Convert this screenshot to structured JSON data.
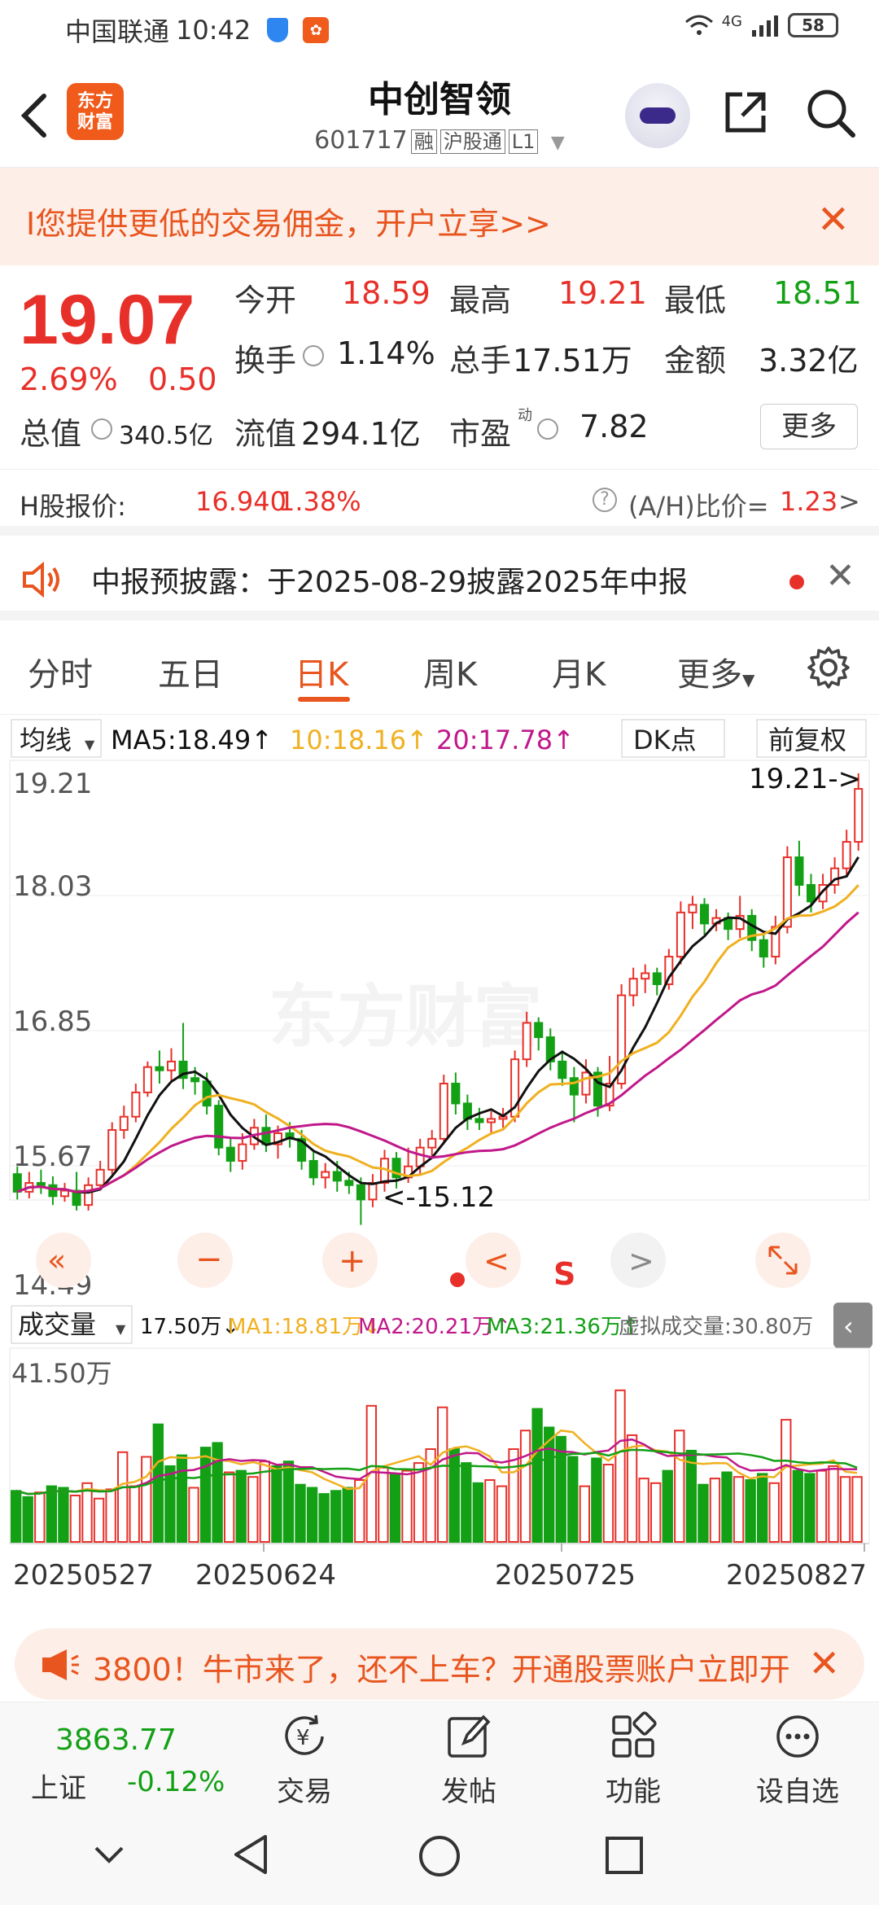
{
  "status_bar": {
    "carrier": "中国联通",
    "time": "10:42",
    "network": "4G",
    "battery": "58"
  },
  "header": {
    "logo_text": "东方\n财富",
    "stock_name": "中创智领",
    "stock_code": "601717",
    "tags": [
      "融",
      "沪股通",
      "L1"
    ]
  },
  "promo_banner": {
    "text": "I您提供更低的交易佣金，开户立享>>"
  },
  "quote": {
    "price": "19.07",
    "change_pct": "2.69%",
    "change_amt": "0.50",
    "rows": [
      [
        {
          "label": "今开",
          "value": "18.59",
          "color": "red"
        },
        {
          "label": "最高",
          "value": "19.21",
          "color": "red"
        },
        {
          "label": "最低",
          "value": "18.51",
          "color": "green"
        }
      ],
      [
        {
          "label": "换手",
          "value": "1.14%",
          "color": "black"
        },
        {
          "label": "总手",
          "value": "17.51万",
          "color": "black"
        },
        {
          "label": "金额",
          "value": "3.32亿",
          "color": "black"
        }
      ],
      [
        {
          "label": "总值",
          "value": "340.5亿",
          "color": "black"
        },
        {
          "label": "流值",
          "value": "294.1亿",
          "color": "black"
        },
        {
          "label": "市盈",
          "value": "7.82",
          "color": "black"
        }
      ]
    ],
    "more_label": "更多",
    "pe_superscript": "动"
  },
  "h_share": {
    "label": "H股报价:",
    "price": "16.940",
    "pct": "1.38%",
    "ratio_label": "(A/H)比价=",
    "ratio": "1.23",
    "arrow": ">"
  },
  "notice": {
    "text": "中报预披露：于2025-08-29披露2025年中报"
  },
  "tabs": [
    "分时",
    "五日",
    "日K",
    "周K",
    "月K",
    "更多"
  ],
  "active_tab": 2,
  "ma_bar": {
    "selector": "均线",
    "ma5": "MA5:18.49↑",
    "ma10": "10:18.16↑",
    "ma20": "20:17.78↑",
    "dk": "DK点",
    "adjust": "前复权"
  },
  "vol_bar": {
    "selector": "成交量",
    "vol": "17.50万↓",
    "ma1": "MA1:18.81万↓",
    "ma2": "MA2:20.21万↑",
    "ma3": "MA3:21.36万↑",
    "virtual": "虚拟成交量:30.80万"
  },
  "chart_data": {
    "type": "candlestick",
    "price_ticks": [
      "19.21",
      "18.03",
      "16.85",
      "15.67",
      "14.49"
    ],
    "price_range": [
      14.49,
      19.21
    ],
    "max_annotation": "19.21->",
    "min_annotation": "<-15.12",
    "volume_max_label": "41.50万",
    "dates": [
      "20250527",
      "20250624",
      "20250725",
      "20250827"
    ],
    "candles": [
      [
        15.58,
        15.42,
        15.65,
        15.35
      ],
      [
        15.42,
        15.5,
        15.6,
        15.36
      ],
      [
        15.5,
        15.48,
        15.62,
        15.4
      ],
      [
        15.48,
        15.38,
        15.56,
        15.3
      ],
      [
        15.38,
        15.43,
        15.5,
        15.33
      ],
      [
        15.43,
        15.3,
        15.6,
        15.25
      ],
      [
        15.3,
        15.48,
        15.55,
        15.25
      ],
      [
        15.48,
        15.62,
        15.7,
        15.45
      ],
      [
        15.62,
        15.98,
        16.05,
        15.58
      ],
      [
        15.98,
        16.1,
        16.2,
        15.9
      ],
      [
        16.1,
        16.32,
        16.4,
        16.05
      ],
      [
        16.32,
        16.55,
        16.6,
        16.28
      ],
      [
        16.55,
        16.52,
        16.7,
        16.4
      ],
      [
        16.52,
        16.6,
        16.72,
        16.42
      ],
      [
        16.6,
        16.45,
        16.95,
        16.35
      ],
      [
        16.45,
        16.42,
        16.55,
        16.3
      ],
      [
        16.42,
        16.2,
        16.5,
        16.12
      ],
      [
        16.2,
        15.82,
        16.25,
        15.75
      ],
      [
        15.82,
        15.7,
        15.9,
        15.6
      ],
      [
        15.7,
        15.85,
        15.95,
        15.62
      ],
      [
        15.85,
        16.0,
        16.08,
        15.8
      ],
      [
        16.0,
        15.85,
        16.12,
        15.78
      ],
      [
        15.85,
        15.95,
        16.02,
        15.72
      ],
      [
        15.95,
        15.9,
        16.05,
        15.82
      ],
      [
        15.9,
        15.7,
        15.98,
        15.62
      ],
      [
        15.7,
        15.55,
        15.78,
        15.48
      ],
      [
        15.55,
        15.6,
        15.68,
        15.45
      ],
      [
        15.6,
        15.52,
        15.7,
        15.42
      ],
      [
        15.52,
        15.48,
        15.6,
        15.4
      ],
      [
        15.48,
        15.35,
        15.55,
        15.12
      ],
      [
        15.35,
        15.5,
        15.58,
        15.28
      ],
      [
        15.5,
        15.72,
        15.8,
        15.42
      ],
      [
        15.72,
        15.55,
        15.78,
        15.45
      ],
      [
        15.55,
        15.65,
        15.82,
        15.5
      ],
      [
        15.65,
        15.82,
        15.9,
        15.58
      ],
      [
        15.82,
        15.9,
        15.98,
        15.72
      ],
      [
        15.9,
        16.4,
        16.48,
        15.85
      ],
      [
        16.4,
        16.22,
        16.5,
        16.12
      ],
      [
        16.22,
        16.08,
        16.3,
        15.98
      ],
      [
        16.08,
        16.05,
        16.18,
        15.98
      ],
      [
        16.05,
        16.08,
        16.15,
        15.95
      ],
      [
        16.08,
        16.1,
        16.18,
        16.0
      ],
      [
        16.1,
        16.62,
        16.7,
        16.05
      ],
      [
        16.62,
        16.95,
        17.05,
        16.55
      ],
      [
        16.95,
        16.82,
        17.0,
        16.7
      ],
      [
        16.82,
        16.6,
        16.9,
        16.52
      ],
      [
        16.6,
        16.45,
        16.7,
        16.38
      ],
      [
        16.45,
        16.3,
        16.55,
        16.05
      ],
      [
        16.3,
        16.5,
        16.62,
        16.22
      ],
      [
        16.5,
        16.2,
        16.55,
        16.1
      ],
      [
        16.2,
        16.4,
        16.65,
        16.15
      ],
      [
        16.4,
        17.2,
        17.3,
        16.35
      ],
      [
        17.2,
        17.35,
        17.45,
        17.1
      ],
      [
        17.35,
        17.4,
        17.48,
        17.22
      ],
      [
        17.4,
        17.3,
        17.45,
        17.2
      ],
      [
        17.3,
        17.55,
        17.62,
        17.25
      ],
      [
        17.55,
        17.95,
        18.05,
        17.48
      ],
      [
        17.95,
        18.02,
        18.1,
        17.8
      ],
      [
        18.02,
        17.85,
        18.08,
        17.75
      ],
      [
        17.85,
        17.9,
        17.98,
        17.78
      ],
      [
        17.9,
        17.8,
        17.95,
        17.7
      ],
      [
        17.8,
        17.92,
        18.1,
        17.72
      ],
      [
        17.92,
        17.7,
        17.98,
        17.6
      ],
      [
        17.7,
        17.55,
        17.78,
        17.45
      ],
      [
        17.55,
        17.82,
        17.92,
        17.48
      ],
      [
        17.82,
        18.45,
        18.55,
        17.76
      ],
      [
        18.45,
        18.2,
        18.6,
        18.1
      ],
      [
        18.2,
        18.05,
        18.3,
        17.95
      ],
      [
        18.05,
        18.2,
        18.3,
        17.98
      ],
      [
        18.2,
        18.35,
        18.45,
        18.12
      ],
      [
        18.35,
        18.59,
        18.7,
        18.28
      ],
      [
        18.59,
        19.07,
        19.21,
        18.51
      ]
    ],
    "volumes": [
      [
        0.33,
        "d"
      ],
      [
        0.29,
        "d"
      ],
      [
        0.32,
        "u"
      ],
      [
        0.36,
        "d"
      ],
      [
        0.35,
        "d"
      ],
      [
        0.3,
        "u"
      ],
      [
        0.38,
        "u"
      ],
      [
        0.28,
        "u"
      ],
      [
        0.34,
        "u"
      ],
      [
        0.58,
        "u"
      ],
      [
        0.36,
        "u"
      ],
      [
        0.55,
        "u"
      ],
      [
        0.76,
        "d"
      ],
      [
        0.49,
        "d"
      ],
      [
        0.56,
        "d"
      ],
      [
        0.35,
        "u"
      ],
      [
        0.61,
        "d"
      ],
      [
        0.64,
        "d"
      ],
      [
        0.45,
        "u"
      ],
      [
        0.46,
        "d"
      ],
      [
        0.42,
        "u"
      ],
      [
        0.52,
        "u"
      ],
      [
        0.49,
        "d"
      ],
      [
        0.52,
        "d"
      ],
      [
        0.37,
        "d"
      ],
      [
        0.35,
        "d"
      ],
      [
        0.31,
        "d"
      ],
      [
        0.33,
        "d"
      ],
      [
        0.35,
        "d"
      ],
      [
        0.4,
        "u"
      ],
      [
        0.88,
        "u"
      ],
      [
        0.48,
        "u"
      ],
      [
        0.44,
        "d"
      ],
      [
        0.46,
        "u"
      ],
      [
        0.51,
        "u"
      ],
      [
        0.6,
        "u"
      ],
      [
        0.87,
        "u"
      ],
      [
        0.6,
        "d"
      ],
      [
        0.51,
        "d"
      ],
      [
        0.38,
        "d"
      ],
      [
        0.4,
        "u"
      ],
      [
        0.36,
        "u"
      ],
      [
        0.6,
        "u"
      ],
      [
        0.72,
        "u"
      ],
      [
        0.86,
        "d"
      ],
      [
        0.74,
        "d"
      ],
      [
        0.68,
        "d"
      ],
      [
        0.55,
        "d"
      ],
      [
        0.36,
        "u"
      ],
      [
        0.54,
        "d"
      ],
      [
        0.5,
        "u"
      ],
      [
        0.98,
        "u"
      ],
      [
        0.69,
        "u"
      ],
      [
        0.41,
        "u"
      ],
      [
        0.38,
        "u"
      ],
      [
        0.46,
        "d"
      ],
      [
        0.72,
        "u"
      ],
      [
        0.59,
        "d"
      ],
      [
        0.37,
        "d"
      ],
      [
        0.41,
        "u"
      ],
      [
        0.45,
        "d"
      ],
      [
        0.42,
        "u"
      ],
      [
        0.4,
        "d"
      ],
      [
        0.44,
        "d"
      ],
      [
        0.38,
        "u"
      ],
      [
        0.79,
        "u"
      ],
      [
        0.46,
        "d"
      ],
      [
        0.44,
        "d"
      ],
      [
        0.46,
        "u"
      ],
      [
        0.49,
        "u"
      ],
      [
        0.42,
        "u"
      ],
      [
        0.42,
        "u"
      ]
    ]
  },
  "chart_controls": {
    "prev": "<",
    "s_label": "S",
    "next": ">"
  },
  "bottom_promo": {
    "text": "3800！牛市来了，还不上车？开通股票账户立即开"
  },
  "tabbar": {
    "index_value": "3863.77",
    "index_name": "上证",
    "index_change": "-0.12%",
    "items": [
      "交易",
      "发帖",
      "功能",
      "设自选"
    ]
  },
  "colors": {
    "up": "#e8302a",
    "down": "#13a015",
    "accent": "#e8551e",
    "ma5": "#111111",
    "ma10": "#f0b020",
    "ma20": "#c0188a"
  }
}
